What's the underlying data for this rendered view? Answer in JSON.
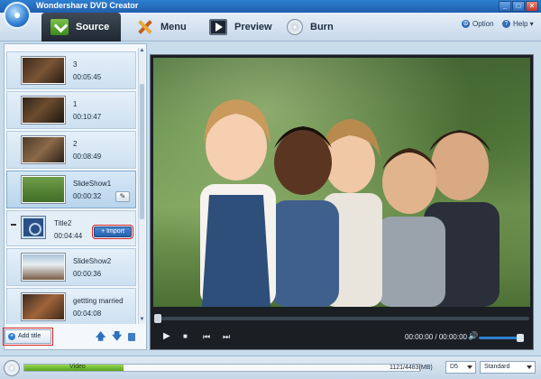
{
  "window": {
    "title": "Wondershare DVD Creator",
    "controls": [
      "_",
      "□",
      "×"
    ]
  },
  "tabs": [
    {
      "label": "Source",
      "icon": "source-icon",
      "active": true
    },
    {
      "label": "Menu",
      "icon": "menu-icon",
      "active": false
    },
    {
      "label": "Preview",
      "icon": "preview-icon",
      "active": false
    },
    {
      "label": "Burn",
      "icon": "burn-icon",
      "active": false
    }
  ],
  "toolbar_right": {
    "option_label": "Option",
    "help_label": "Help ▾"
  },
  "list": {
    "items": [
      {
        "name": "3",
        "duration": "00:05:45",
        "thumb_icon": "video-thumbnail"
      },
      {
        "name": "1",
        "duration": "00:10:47",
        "thumb_icon": "video-thumbnail"
      },
      {
        "name": "2",
        "duration": "00:08:49",
        "thumb_icon": "video-thumbnail"
      },
      {
        "name": "SlideShow1",
        "duration": "00:00:32",
        "thumb_icon": "slideshow-thumbnail",
        "selected": true
      },
      {
        "name": "Title2",
        "duration": "00:04:44",
        "thumb_icon": "film-icon",
        "is_title": true,
        "import_label": "+ Import"
      },
      {
        "name": "SlideShow2",
        "duration": "00:00:36",
        "thumb_icon": "slideshow-thumbnail"
      },
      {
        "name": "gettting married",
        "duration": "00:04:08",
        "thumb_icon": "video-thumbnail"
      }
    ],
    "add_title_label": "Add title"
  },
  "player": {
    "current_time": "00:00:00",
    "separator": "/",
    "total_time": "00:00:00"
  },
  "status": {
    "media_label": "Video",
    "size_text": "1121/4483(MB)",
    "disc_type": "D5",
    "quality": "Standard",
    "used_fraction": 0.25
  },
  "colors": {
    "accent": "#2f7fd0",
    "capacity": "#56a21d",
    "highlight": "#dd2222"
  }
}
